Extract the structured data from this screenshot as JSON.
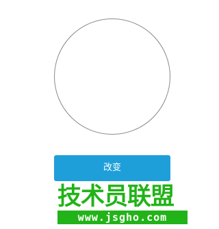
{
  "avatar": {
    "border_color": "#8a8a8a"
  },
  "actions": {
    "change_label": "改变",
    "accent_color": "#1f9fd9"
  },
  "watermark": {
    "site_name": "技术员联盟",
    "site_url": "www.jsgho.com",
    "color": "#22b318"
  }
}
